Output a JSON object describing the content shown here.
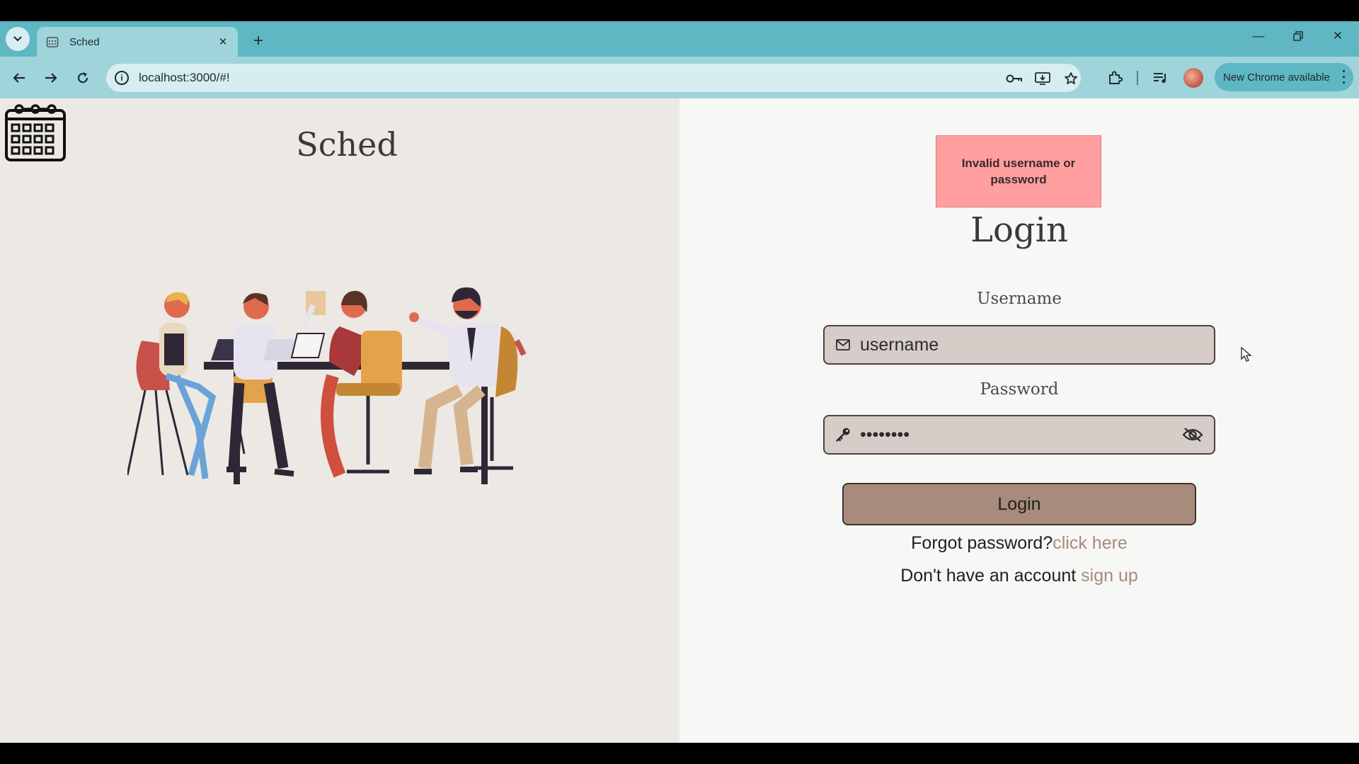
{
  "browser": {
    "tab_title": "Sched",
    "url": "localhost:3000/#!",
    "update_label": "New Chrome available",
    "icons": [
      "tab-search-icon",
      "calendar-favicon",
      "close-icon",
      "plus-icon",
      "minimize-icon",
      "restore-icon",
      "window-close-icon",
      "back-icon",
      "forward-icon",
      "reload-icon",
      "info-icon",
      "password-key-icon",
      "install-app-icon",
      "star-icon",
      "extensions-icon",
      "media-controls-icon",
      "profile-avatar",
      "more-vert-icon"
    ]
  },
  "brand": {
    "title": "Sched",
    "logo_icon": "calendar-icon"
  },
  "login": {
    "error_message": "Invalid username or password",
    "title": "Login",
    "username_label": "Username",
    "username_placeholder": "username",
    "username_icon": "mail-icon",
    "password_label": "Password",
    "password_value": "••••••••",
    "password_icon": "key-icon",
    "password_toggle_icon": "eye-off-icon",
    "submit_label": "Login",
    "forgot_text": "Forgot password?",
    "forgot_link": "click here",
    "signup_text": "Don't have an account ",
    "signup_link": "sign up"
  },
  "colors": {
    "tabstrip": "#5eb7c2",
    "toolbar": "#9fd4db",
    "left_panel": "#ece8e4",
    "right_panel": "#f7f7f6",
    "error_bg": "#ff9f9f",
    "input_bg": "#d6cdc8",
    "button_bg": "#a78b7c",
    "link": "#a78b7c"
  }
}
